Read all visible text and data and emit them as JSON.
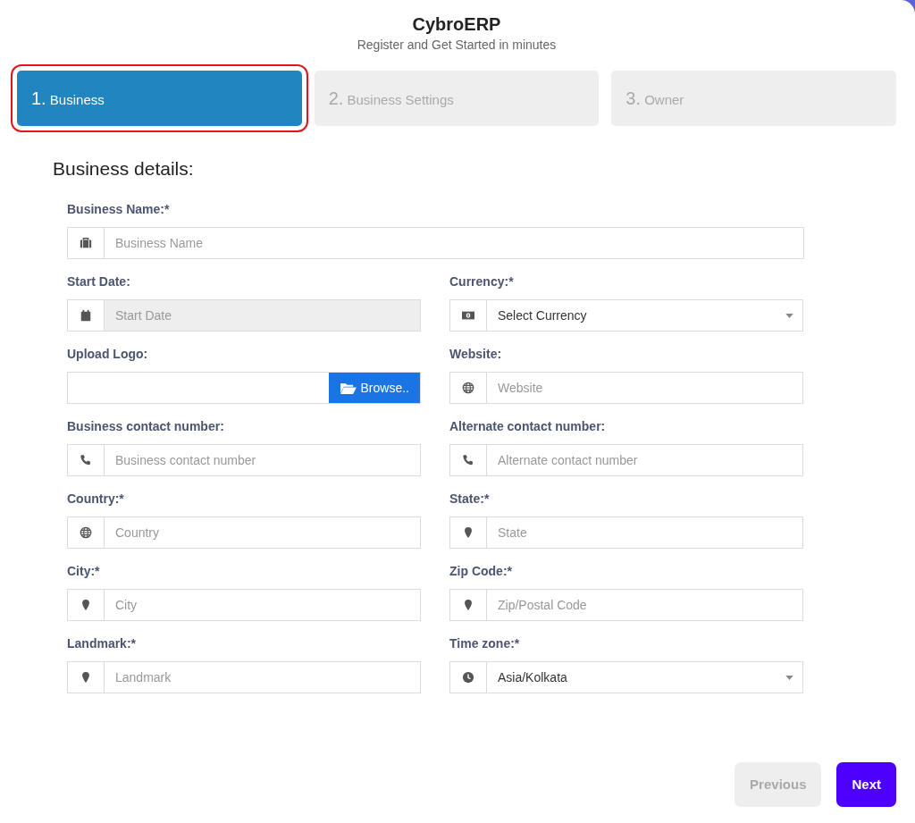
{
  "header": {
    "title": "CybroERP",
    "subtitle": "Register and Get Started in minutes"
  },
  "steps": [
    {
      "number": "1.",
      "label": "Business",
      "selected": true
    },
    {
      "number": "2.",
      "label": "Business Settings",
      "selected": false
    },
    {
      "number": "3.",
      "label": "Owner",
      "selected": false
    }
  ],
  "section_title": "Business details:",
  "fields": [
    {
      "label": "Business Name:*",
      "kind": "text",
      "placeholder": "Business Name",
      "wide": true
    },
    {
      "label": "Start Date:",
      "kind": "date",
      "placeholder": "Start Date",
      "disabled": true
    },
    {
      "label": "Currency:*",
      "kind": "select",
      "value": "Select Currency"
    },
    {
      "label": "Upload Logo:",
      "kind": "file",
      "button": "Browse.."
    },
    {
      "label": "Website:",
      "kind": "text",
      "placeholder": "Website"
    },
    {
      "label": "Business contact number:",
      "kind": "text",
      "placeholder": "Business contact number"
    },
    {
      "label": "Alternate contact number:",
      "kind": "text",
      "placeholder": "Alternate contact number"
    },
    {
      "label": "Country:*",
      "kind": "text",
      "placeholder": "Country"
    },
    {
      "label": "State:*",
      "kind": "text",
      "placeholder": "State"
    },
    {
      "label": "City:*",
      "kind": "text",
      "placeholder": "City"
    },
    {
      "label": "Zip Code:*",
      "kind": "text",
      "placeholder": "Zip/Postal Code"
    },
    {
      "label": "Landmark:*",
      "kind": "text",
      "placeholder": "Landmark"
    },
    {
      "label": "Time zone:*",
      "kind": "select",
      "value": "Asia/Kolkata"
    }
  ],
  "buttons": [
    {
      "label": "Previous",
      "kind": "previous",
      "disabled": true
    },
    {
      "label": "Next",
      "kind": "next",
      "disabled": false
    }
  ]
}
